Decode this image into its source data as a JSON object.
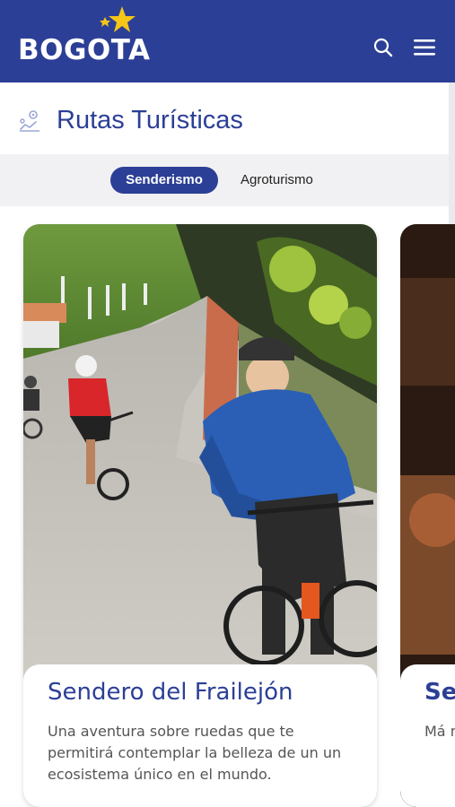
{
  "header": {
    "logo_text": "BOGOTA",
    "background_color": "#2c3f96",
    "star_color": "#f5c518",
    "search_icon": "search-icon",
    "menu_icon": "hamburger-menu-icon"
  },
  "section": {
    "title": "Rutas Turísticas",
    "icon": "route-map-icon"
  },
  "tabs": [
    {
      "label": "Senderismo",
      "active": true
    },
    {
      "label": "Agroturismo",
      "active": false
    }
  ],
  "cards": [
    {
      "title": "Sendero del Frailejón",
      "description": "Una aventura sobre ruedas que te permitirá contemplar la belleza de un un ecosistema único en el mundo.",
      "image": "cyclists-on-mountain-road-photo"
    },
    {
      "title": "Se",
      "description": "Má mi adr co",
      "image": "partial-next-route-photo"
    }
  ]
}
